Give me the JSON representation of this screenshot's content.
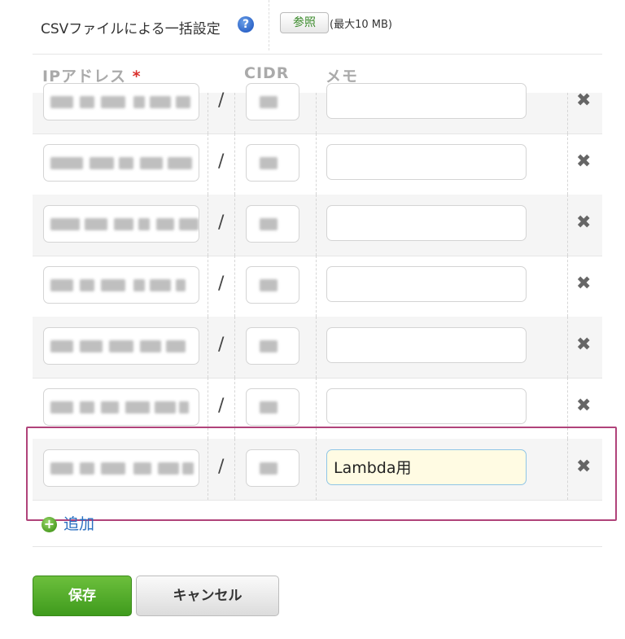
{
  "csv": {
    "label": "CSVファイルによる一括設定",
    "browse_label": "参照",
    "size_note": "(最大10 MB)"
  },
  "table": {
    "headers": {
      "ip": "IPアドレス",
      "required_mark": "*",
      "cidr": "CIDR",
      "memo": "メモ"
    },
    "separator": "/",
    "rows": [
      {
        "memo": "",
        "redacted": true
      },
      {
        "memo": "",
        "redacted": true
      },
      {
        "memo": "",
        "redacted": true
      },
      {
        "memo": "",
        "redacted": true
      },
      {
        "memo": "",
        "redacted": true
      },
      {
        "memo": "",
        "redacted": true
      },
      {
        "memo": "Lambda用",
        "redacted": true,
        "highlighted": true,
        "focused": true
      }
    ]
  },
  "add_label": "追加",
  "buttons": {
    "save": "保存",
    "cancel": "キャンセル"
  },
  "colors": {
    "highlight": "#b0437a",
    "save": "#4ea628",
    "link": "#2a6fc1",
    "required": "#d9302c"
  }
}
